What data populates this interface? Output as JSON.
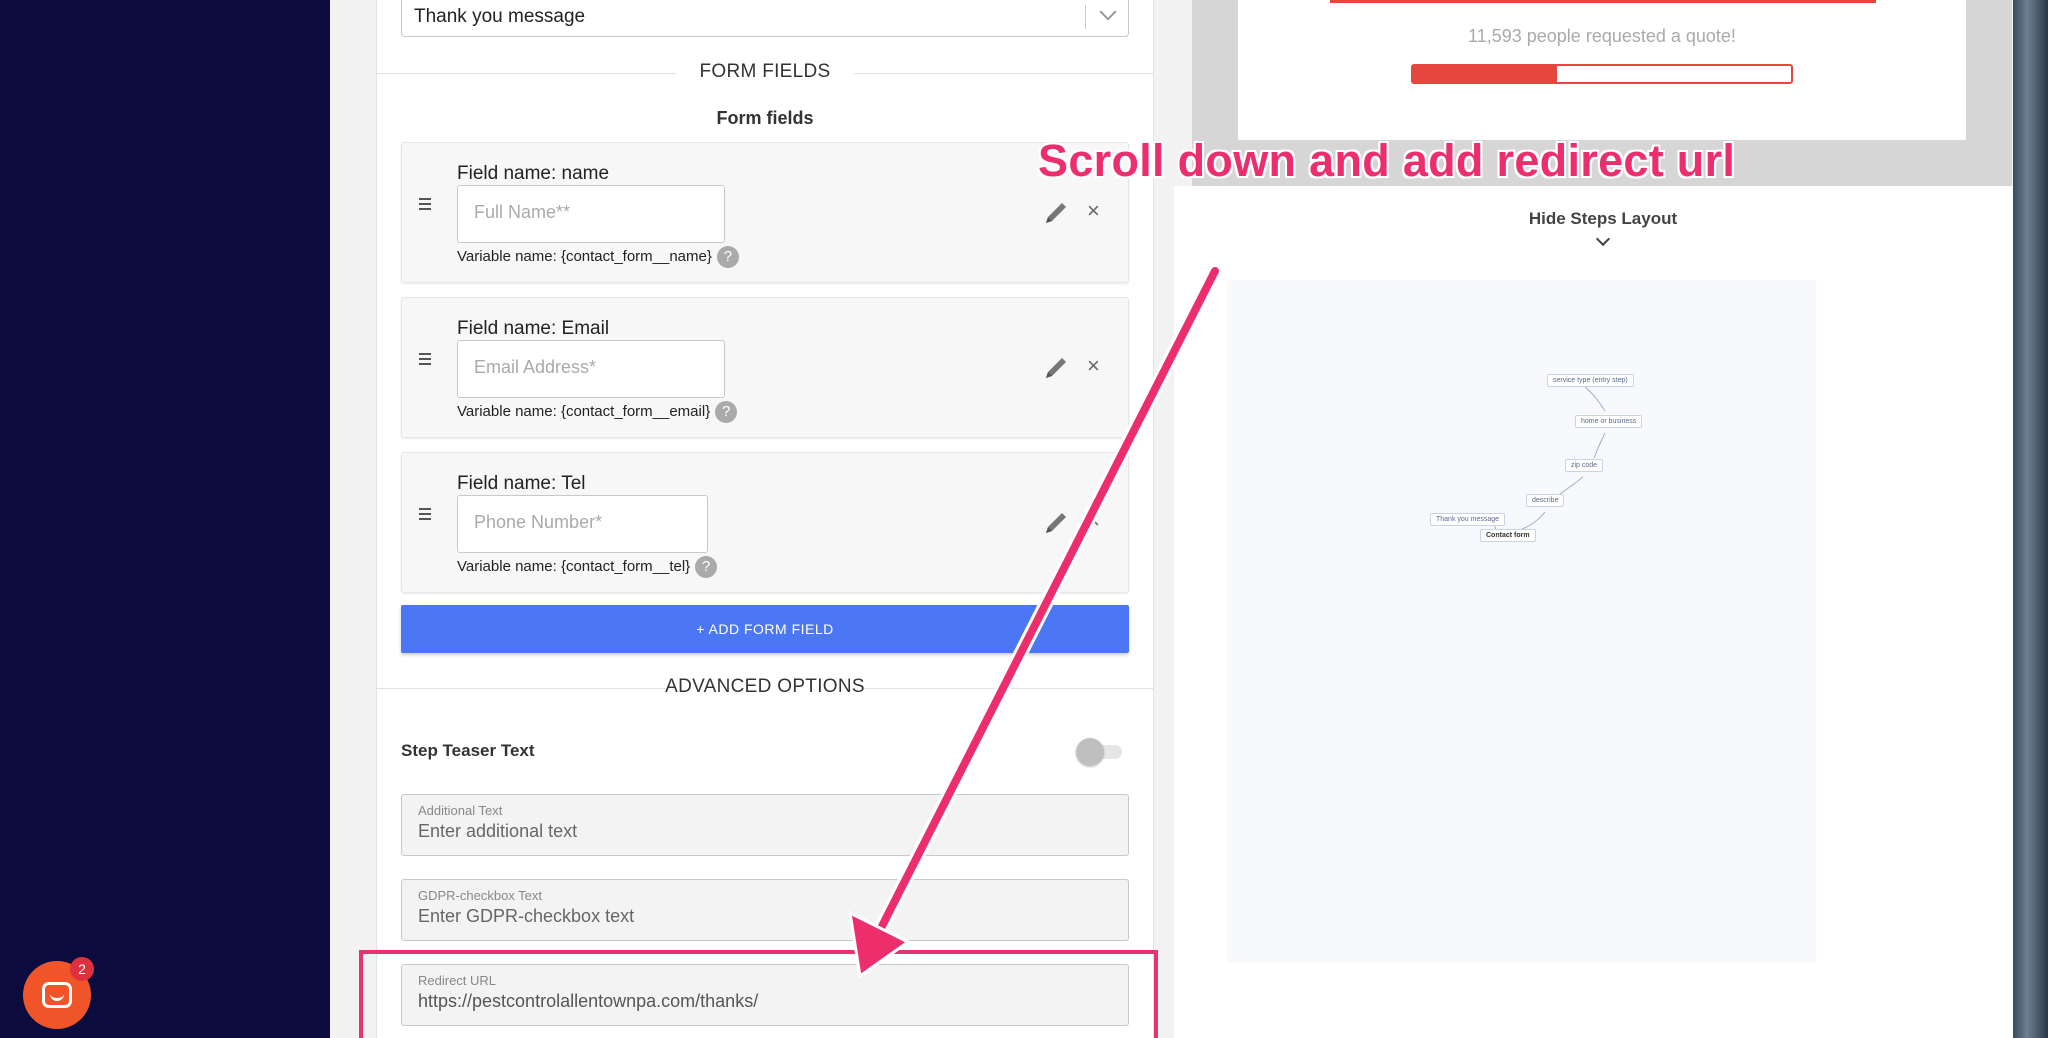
{
  "thank_you_select": {
    "value": "Thank you message"
  },
  "form_fields_section": {
    "title": "FORM FIELDS",
    "subtitle": "Form fields"
  },
  "fields": [
    {
      "name_label": "Field name: name",
      "placeholder": "Full Name**",
      "variable": "Variable name: {contact_form__name}"
    },
    {
      "name_label": "Field name: Email",
      "placeholder": "Email Address*",
      "variable": "Variable name: {contact_form__email}"
    },
    {
      "name_label": "Field name: Tel",
      "placeholder": "Phone Number*",
      "variable": "Variable name: {contact_form__tel}"
    }
  ],
  "help_glyph": "?",
  "delete_glyph": "×",
  "add_field_button": "+ ADD FORM FIELD",
  "advanced": {
    "title": "ADVANCED OPTIONS",
    "teaser_label": "Step Teaser Text",
    "teaser_enabled": false,
    "additional_text": {
      "label": "Additional Text",
      "placeholder": "Enter additional text"
    },
    "gdpr_text": {
      "label": "GDPR-checkbox Text",
      "placeholder": "Enter GDPR-checkbox text"
    },
    "redirect_url": {
      "label": "Redirect URL",
      "value": "https://pestcontrolallentownpa.com/thanks/"
    }
  },
  "preview": {
    "requested_text": "11,593 people requested a quote!",
    "progress_fraction": 0.38,
    "hide_steps_label": "Hide Steps Layout",
    "flow_nodes": [
      "service type (entry step)",
      "home or business",
      "zip code",
      "describe",
      "Thank you message",
      "Contact form"
    ]
  },
  "chat": {
    "badge_count": "2"
  },
  "annotation": {
    "text": "Scroll down and add redirect url",
    "color": "#ec2f6c"
  },
  "colors": {
    "accent_blue": "#4b77f5",
    "preview_red": "#e5473f",
    "highlight_pink": "#e8336d"
  }
}
